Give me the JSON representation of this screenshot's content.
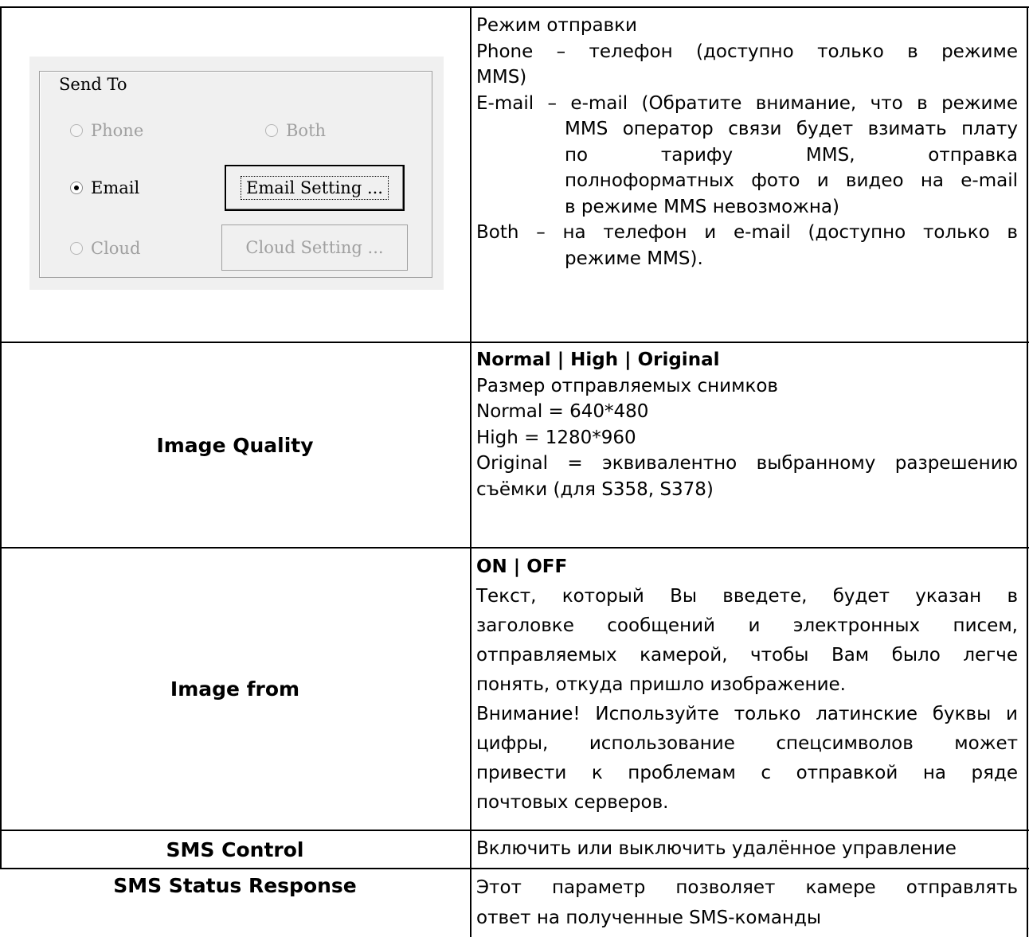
{
  "send_to_dialog": {
    "group_title": "Send To",
    "radios": {
      "phone": "Phone",
      "both": "Both",
      "email": "Email",
      "cloud": "Cloud"
    },
    "selected": "Email",
    "buttons": {
      "email_setting": "Email Setting ...",
      "cloud_setting": "Cloud Setting ..."
    }
  },
  "rows": {
    "send_to": {
      "lines": [
        "Режим отправки",
        "Phone – телефон (доступно только в режиме",
        "MMS)",
        "E-mail – e-mail (Обратите внимание, что в режиме",
        "MMS оператор связи будет взимать плату",
        "по тарифу MMS, отправка",
        "полноформатных фото и видео на e-mail",
        "в режиме MMS невозможна)",
        "Both – на телефон и e-mail (доступно только в",
        "режиме MMS)."
      ]
    },
    "image_quality": {
      "label": "Image Quality",
      "lines": [
        "Normal | High | Original",
        "Размер отправляемых снимков",
        "Normal = 640*480",
        "High = 1280*960",
        "Original = эквивалентно выбранному разрешению",
        "съёмки (для S358, S378)"
      ]
    },
    "image_from": {
      "label": "Image from",
      "lines": [
        "ON | OFF",
        "Текст, который Вы введете, будет указан в",
        "заголовке сообщений и электронных писем,",
        "отправляемых камерой, чтобы Вам было легче",
        "понять, откуда пришло изображение.",
        "Внимание! Используйте только латинские буквы и",
        "цифры, использование спецсимволов может",
        "привести к проблемам с отправкой на ряде",
        "почтовых серверов."
      ]
    },
    "sms_control": {
      "label": "SMS Control",
      "lines": [
        "Включить или выключить удалённое управление"
      ]
    },
    "sms_status": {
      "label": "SMS Status Response",
      "lines": [
        "Этот параметр позволяет камере отправлять",
        "ответ на полученные SMS-команды"
      ]
    }
  }
}
